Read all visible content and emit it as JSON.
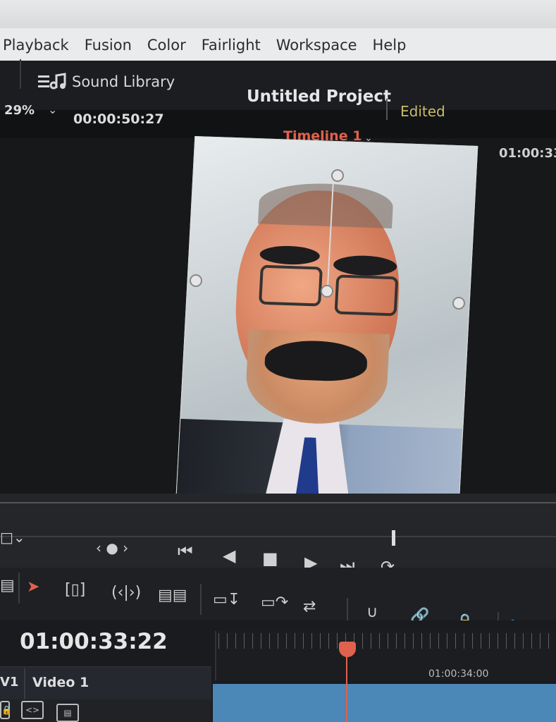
{
  "menubar": {
    "items": [
      "Playback",
      "Fusion",
      "Color",
      "Fairlight",
      "Workspace",
      "Help"
    ]
  },
  "toolbar": {
    "sound_library_label": "Sound Library",
    "project_title": "Untitled Project",
    "project_status": "Edited"
  },
  "viewer": {
    "zoom": "29%",
    "source_timecode": "00:00:50:27",
    "timeline_name": "Timeline 1",
    "timeline_timecode_partial": "01:00:33"
  },
  "timeline": {
    "current_timecode": "01:00:33:22",
    "ruler_label": "01:00:34:00",
    "track_id": "V1",
    "track_name": "Video 1"
  },
  "colors": {
    "accent_playhead": "#e0614e",
    "edited_status": "#c8bd6a",
    "clip": "#4b87b7"
  }
}
